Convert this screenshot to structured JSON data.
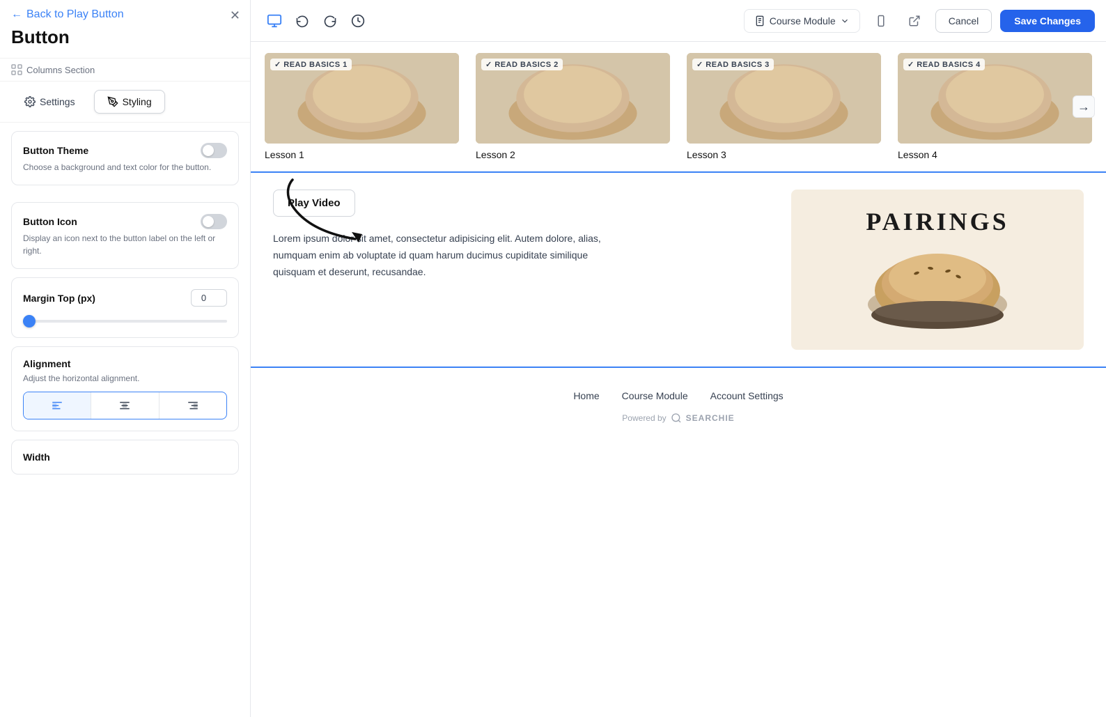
{
  "panel": {
    "back_label": "Back to Play Button",
    "title": "Button",
    "breadcrumb": "Columns Section",
    "tabs": [
      {
        "id": "settings",
        "label": "Settings",
        "icon": "gear"
      },
      {
        "id": "styling",
        "label": "Styling",
        "icon": "brush",
        "active": true
      }
    ],
    "button_theme": {
      "label": "Button Theme",
      "description": "Choose a background and text color for the button."
    },
    "button_icon": {
      "label": "Button Icon",
      "description": "Display an icon next to the button label on the left or right."
    },
    "margin_top": {
      "label": "Margin Top (px)",
      "value": "0"
    },
    "alignment": {
      "label": "Alignment",
      "description": "Adjust the horizontal alignment.",
      "options": [
        "left",
        "center",
        "right"
      ],
      "active": "left"
    },
    "width": {
      "label": "Width"
    }
  },
  "topbar": {
    "save_label": "Save Changes",
    "cancel_label": "Cancel",
    "course_module_label": "Course Module"
  },
  "lessons": [
    {
      "badge": "✓ READ BASICS 1",
      "title": "Lesson 1"
    },
    {
      "badge": "✓ READ BASICS 2",
      "title": "Lesson 2"
    },
    {
      "badge": "✓ READ BASICS 3",
      "title": "Lesson 3"
    },
    {
      "badge": "✓ READ BASICS 4",
      "title": "Lesson 4"
    }
  ],
  "play_section": {
    "button_label": "Play Video",
    "lorem": "Lorem ipsum dolor sit amet, consectetur adipisicing elit. Autem dolore, alias, numquam enim ab voluptate id quam harum ducimus cupiditate similique quisquam et deserunt, recusandae.",
    "pairings_title": "PAIRINGS"
  },
  "footer": {
    "nav": [
      {
        "label": "Home"
      },
      {
        "label": "Course Module"
      },
      {
        "label": "Account Settings"
      }
    ],
    "powered_by": "Powered by",
    "brand": "SEARCHIE"
  }
}
